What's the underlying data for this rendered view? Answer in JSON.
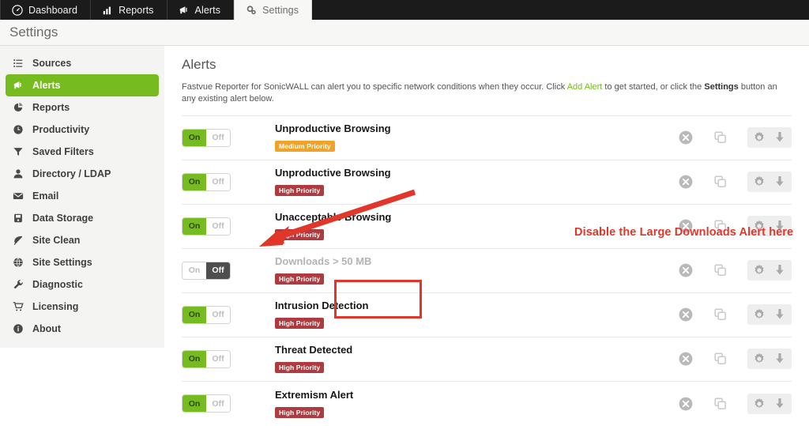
{
  "topnav": {
    "tabs": [
      {
        "label": "Dashboard",
        "icon": "gauge-icon",
        "active": false
      },
      {
        "label": "Reports",
        "icon": "bar-chart-icon",
        "active": false
      },
      {
        "label": "Alerts",
        "icon": "megaphone-icon",
        "active": false
      },
      {
        "label": "Settings",
        "icon": "gears-icon",
        "active": true
      }
    ]
  },
  "titlebar": {
    "title": "Settings"
  },
  "sidebar": {
    "items": [
      {
        "label": "Sources",
        "icon": "list-icon",
        "active": false
      },
      {
        "label": "Alerts",
        "icon": "megaphone-icon",
        "active": true
      },
      {
        "label": "Reports",
        "icon": "chart-icon",
        "active": false
      },
      {
        "label": "Productivity",
        "icon": "clock-icon",
        "active": false
      },
      {
        "label": "Saved Filters",
        "icon": "funnel-icon",
        "active": false
      },
      {
        "label": "Directory / LDAP",
        "icon": "person-icon",
        "active": false
      },
      {
        "label": "Email",
        "icon": "envelope-icon",
        "active": false
      },
      {
        "label": "Data Storage",
        "icon": "database-icon",
        "active": false
      },
      {
        "label": "Site Clean",
        "icon": "leaf-icon",
        "active": false
      },
      {
        "label": "Site Settings",
        "icon": "globe-icon",
        "active": false
      },
      {
        "label": "Diagnostic",
        "icon": "wrench-icon",
        "active": false
      },
      {
        "label": "Licensing",
        "icon": "cart-icon",
        "active": false
      },
      {
        "label": "About",
        "icon": "info-icon",
        "active": false
      }
    ]
  },
  "main": {
    "heading": "Alerts",
    "description": {
      "part1": "Fastvue Reporter for SonicWALL can alert you to specific network conditions when they occur. Click ",
      "link": "Add Alert",
      "part2": " to get started, or click the ",
      "bold": "Settings",
      "part3": " button an any existing alert below."
    },
    "toggle_labels": {
      "on": "On",
      "off": "Off"
    },
    "action_icons": [
      {
        "name": "delete-icon"
      },
      {
        "name": "duplicate-icon"
      },
      {
        "name": "gear-icon"
      },
      {
        "name": "download-icon"
      }
    ],
    "alerts": [
      {
        "title": "Unproductive Browsing",
        "priority": "Medium Priority",
        "priority_level": "medium",
        "enabled": true
      },
      {
        "title": "Unproductive Browsing",
        "priority": "High Priority",
        "priority_level": "high",
        "enabled": true
      },
      {
        "title": "Unacceptable Browsing",
        "priority": "High Priority",
        "priority_level": "high",
        "enabled": true
      },
      {
        "title": "Downloads > 50 MB",
        "priority": "High Priority",
        "priority_level": "high",
        "enabled": false
      },
      {
        "title": "Intrusion Detection",
        "priority": "High Priority",
        "priority_level": "high",
        "enabled": true
      },
      {
        "title": "Threat Detected",
        "priority": "High Priority",
        "priority_level": "high",
        "enabled": true
      },
      {
        "title": "Extremism Alert",
        "priority": "High Priority",
        "priority_level": "high",
        "enabled": true
      }
    ]
  },
  "annotations": {
    "callout_text": "Disable the Large Downloads Alert here",
    "color": "#e1372a"
  },
  "colors": {
    "accent_green": "#76bb20",
    "high_priority": "#ae3b3f",
    "medium_priority": "#f0a32a",
    "annotation_red": "#e1372a",
    "nav_dark": "#1b1b1b"
  }
}
